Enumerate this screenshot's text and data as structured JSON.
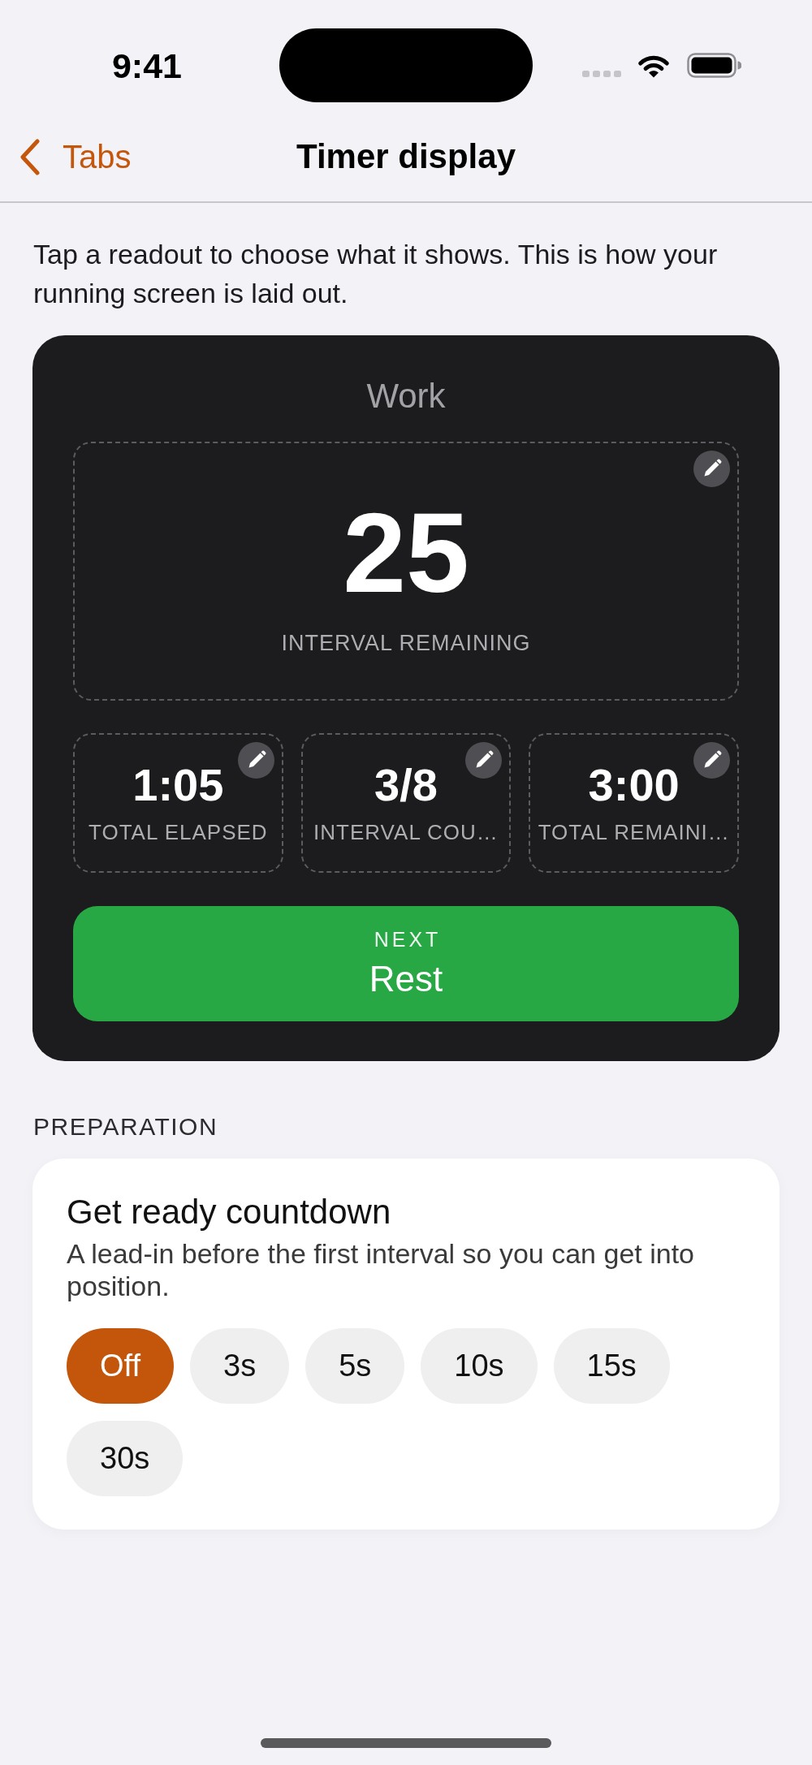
{
  "status_bar": {
    "time": "9:41"
  },
  "nav_bar": {
    "back_label": "Tabs",
    "title": "Timer display"
  },
  "intro": "Tap a readout to choose what it shows. This is how your running screen is laid out.",
  "preview": {
    "phase": "Work",
    "main_readout": {
      "value": "25",
      "label": "INTERVAL REMAINING"
    },
    "readouts": [
      {
        "value": "1:05",
        "label": "TOTAL ELAPSED"
      },
      {
        "value": "3/8",
        "label": "INTERVAL COU…"
      },
      {
        "value": "3:00",
        "label": "TOTAL REMAINI…"
      }
    ],
    "next": {
      "caption": "NEXT",
      "label": "Rest"
    }
  },
  "preparation": {
    "section_title": "PREPARATION",
    "title": "Get ready countdown",
    "description": "A lead-in before the first interval so you can get into position.",
    "options": [
      {
        "label": "Off",
        "selected": true
      },
      {
        "label": "3s",
        "selected": false
      },
      {
        "label": "5s",
        "selected": false
      },
      {
        "label": "10s",
        "selected": false
      },
      {
        "label": "15s",
        "selected": false
      },
      {
        "label": "30s",
        "selected": false
      }
    ]
  }
}
